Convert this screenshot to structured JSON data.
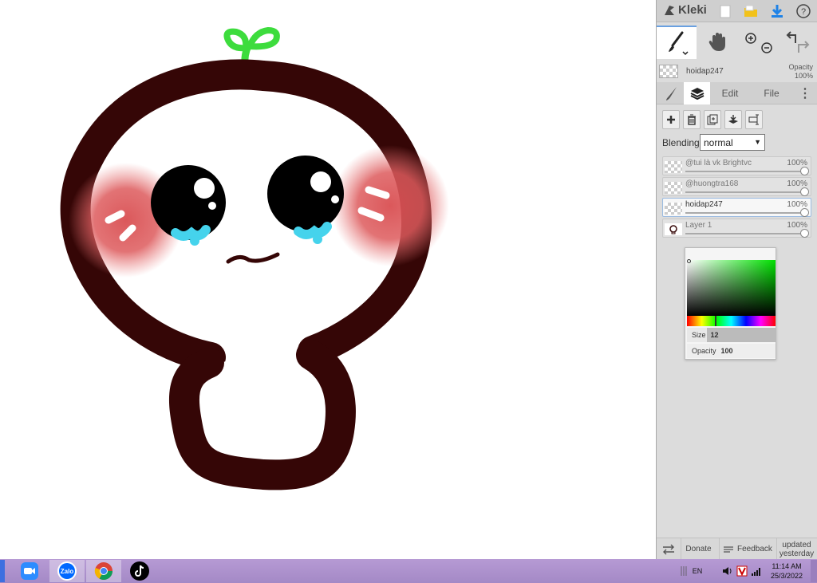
{
  "app": {
    "name": "Kleki",
    "icons": [
      "new-image-icon",
      "open-folder-icon",
      "download-icon",
      "help-icon"
    ]
  },
  "tools": {
    "brush": "brush-icon",
    "hand": "hand-icon",
    "zoom": "zoom-icons",
    "undo_redo": "undo-redo-icons"
  },
  "current_layer": {
    "name": "hoidap247",
    "opacity_label": "Opacity",
    "opacity_value": "100%"
  },
  "tabs": {
    "brush": "brush-tab-icon",
    "layers": "layers-tab-icon",
    "edit": "Edit",
    "file": "File",
    "more": "more-icon"
  },
  "layer_actions": [
    "add-layer-icon",
    "delete-layer-icon",
    "duplicate-layer-icon",
    "merge-down-icon",
    "rename-layer-icon"
  ],
  "blending": {
    "label": "Blending",
    "value": "normal"
  },
  "layers": [
    {
      "name": "@tui là vk Brightvc",
      "opacity": "100%",
      "active": false
    },
    {
      "name": "@huongtra168",
      "opacity": "100%",
      "active": false
    },
    {
      "name": "hoidap247",
      "opacity": "100%",
      "active": true
    },
    {
      "name": "Layer 1",
      "opacity": "100%",
      "active": false
    }
  ],
  "color_picker": {
    "size_label": "Size",
    "size_value": "12",
    "opacity_label": "Opacity",
    "opacity_value": "100",
    "hue_color": "#00e000"
  },
  "sidebar_footer": {
    "donate": "Donate",
    "feedback": "Feedback",
    "updated_line1": "updated",
    "updated_line2": "yesterday"
  },
  "colors": {
    "outline": "#350606",
    "blush": "#d94f52",
    "sprout": "#3ddc3d",
    "tear": "#45d3ec",
    "taskbar": "#a98dc9"
  },
  "taskbar": {
    "apps": [
      "zoom-icon",
      "zalo-icon",
      "chrome-icon",
      "tiktok-icon"
    ],
    "zalo_text": "Zalo",
    "language": "EN",
    "time": "11:14 AM",
    "date": "25/3/2022"
  }
}
